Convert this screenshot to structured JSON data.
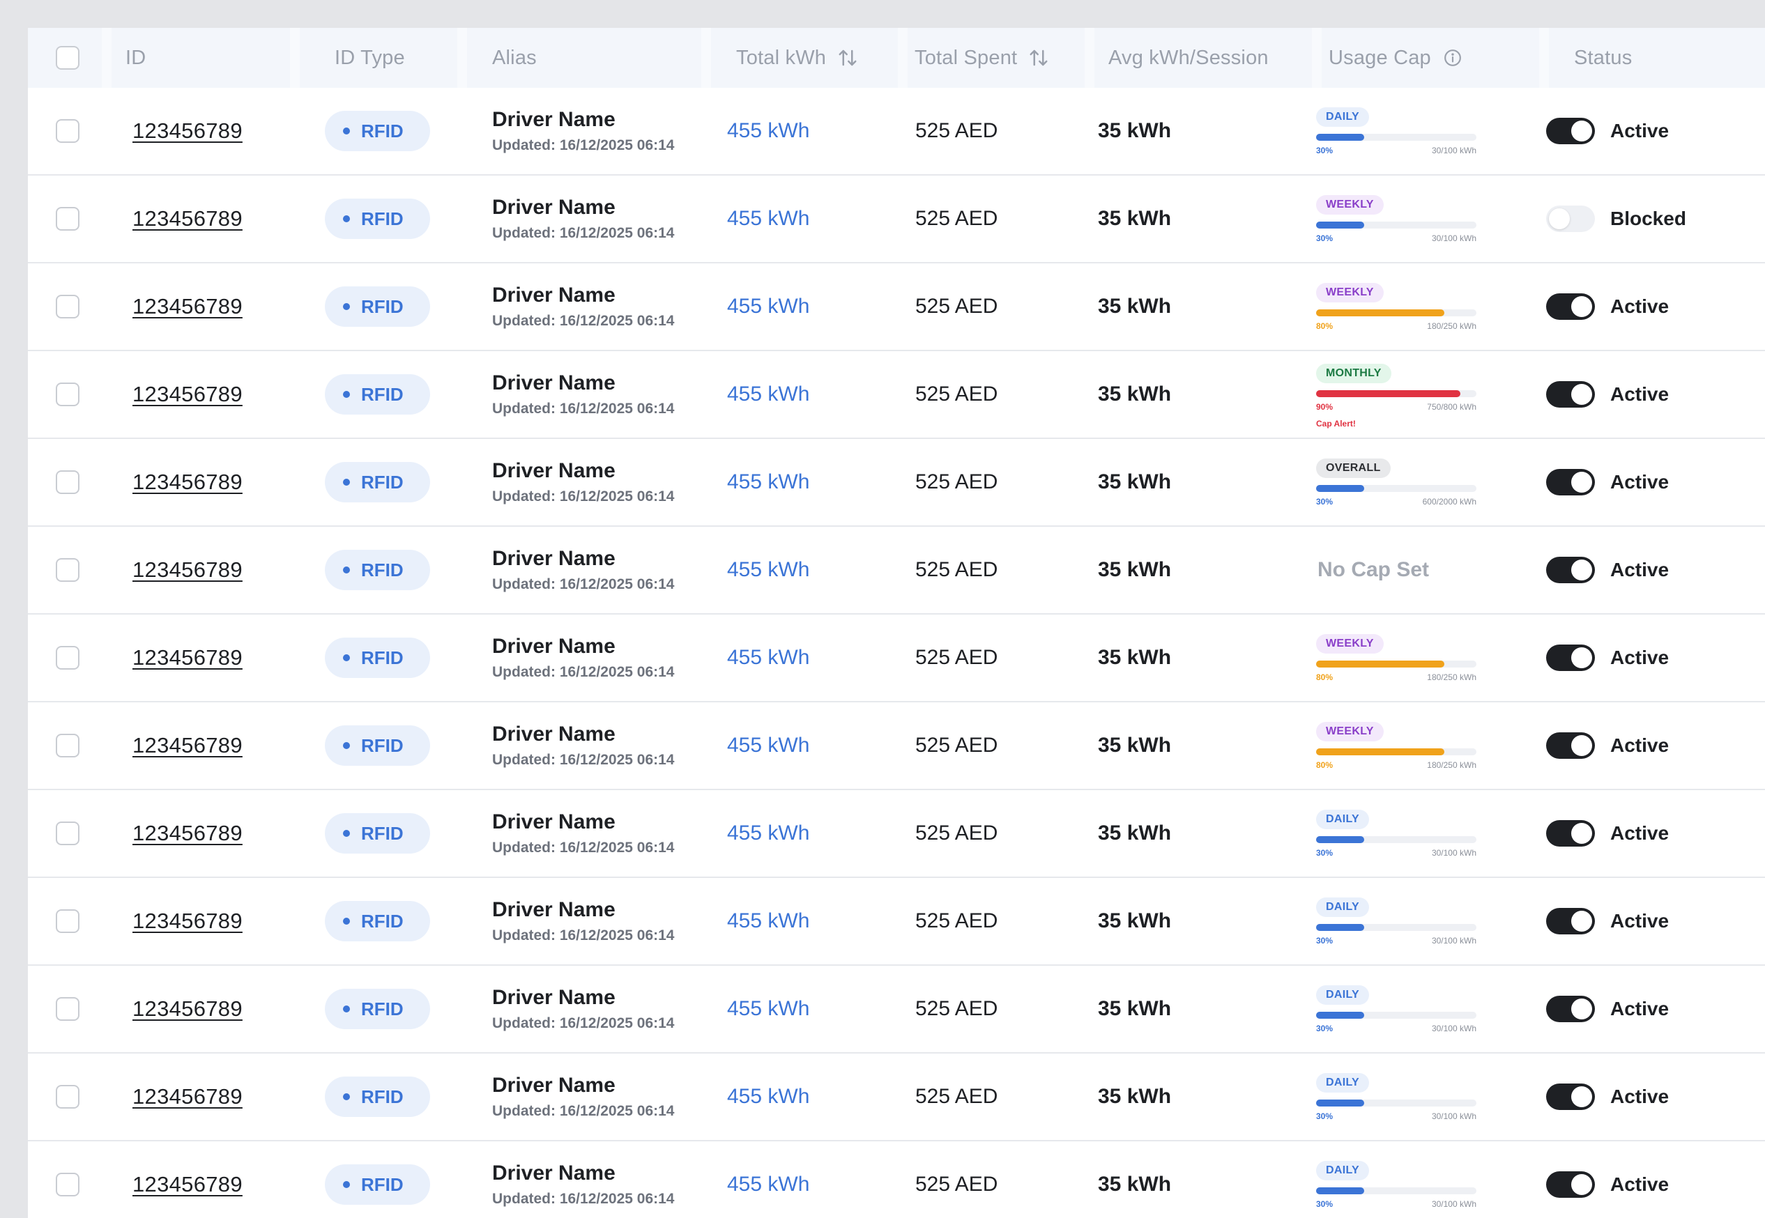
{
  "table": {
    "headers": {
      "id": "ID",
      "id_type": "ID Type",
      "alias": "Alias",
      "total_kwh": "Total kWh",
      "total_spent": "Total Spent",
      "avg": "Avg kWh/Session",
      "usage_cap": "Usage Cap",
      "status": "Status"
    },
    "icons": {
      "sort": "sort-arrows-icon",
      "info": "info-icon",
      "dot": "status-dot-icon"
    },
    "colors": {
      "accent_blue": "#3b74d6",
      "warning_orange": "#f0a21b",
      "danger_red": "#e03342",
      "toggle_on": "#1e2024",
      "muted_text": "#9aa0ab"
    },
    "rows": [
      {
        "id": "123456789",
        "id_type": "RFID",
        "name": "Driver Name",
        "updated": "Updated: 16/12/2025 06:14",
        "kwh": "455 kWh",
        "spent": "525 AED",
        "avg": "35 kWh",
        "cap": {
          "period": "DAILY",
          "color": "blue",
          "fraction": 0.3,
          "pct": "30%",
          "amount": "30/100 kWh",
          "alert": ""
        },
        "status": "Active",
        "on": true
      },
      {
        "id": "123456789",
        "id_type": "RFID",
        "name": "Driver Name",
        "updated": "Updated: 16/12/2025 06:14",
        "kwh": "455 kWh",
        "spent": "525 AED",
        "avg": "35 kWh",
        "cap": {
          "period": "WEEKLY",
          "color": "blue",
          "fraction": 0.3,
          "pct": "30%",
          "amount": "30/100 kWh",
          "alert": ""
        },
        "status": "Blocked",
        "on": false
      },
      {
        "id": "123456789",
        "id_type": "RFID",
        "name": "Driver Name",
        "updated": "Updated: 16/12/2025 06:14",
        "kwh": "455 kWh",
        "spent": "525 AED",
        "avg": "35 kWh",
        "cap": {
          "period": "WEEKLY",
          "color": "orange",
          "fraction": 0.8,
          "pct": "80%",
          "amount": "180/250 kWh",
          "alert": ""
        },
        "status": "Active",
        "on": true
      },
      {
        "id": "123456789",
        "id_type": "RFID",
        "name": "Driver Name",
        "updated": "Updated: 16/12/2025 06:14",
        "kwh": "455 kWh",
        "spent": "525 AED",
        "avg": "35 kWh",
        "cap": {
          "period": "MONTHLY",
          "color": "red",
          "fraction": 0.9,
          "pct": "90%",
          "amount": "750/800 kWh",
          "alert": "Cap Alert!"
        },
        "status": "Active",
        "on": true
      },
      {
        "id": "123456789",
        "id_type": "RFID",
        "name": "Driver Name",
        "updated": "Updated: 16/12/2025 06:14",
        "kwh": "455 kWh",
        "spent": "525 AED",
        "avg": "35 kWh",
        "cap": {
          "period": "OVERALL",
          "color": "blue",
          "fraction": 0.3,
          "pct": "30%",
          "amount": "600/2000 kWh",
          "alert": ""
        },
        "status": "Active",
        "on": true
      },
      {
        "id": "123456789",
        "id_type": "RFID",
        "name": "Driver Name",
        "updated": "Updated: 16/12/2025 06:14",
        "kwh": "455 kWh",
        "spent": "525 AED",
        "avg": "35 kWh",
        "cap": null,
        "no_cap": "No Cap Set",
        "status": "Active",
        "on": true
      },
      {
        "id": "123456789",
        "id_type": "RFID",
        "name": "Driver Name",
        "updated": "Updated: 16/12/2025 06:14",
        "kwh": "455 kWh",
        "spent": "525 AED",
        "avg": "35 kWh",
        "cap": {
          "period": "WEEKLY",
          "color": "orange",
          "fraction": 0.8,
          "pct": "80%",
          "amount": "180/250 kWh",
          "alert": ""
        },
        "status": "Active",
        "on": true
      },
      {
        "id": "123456789",
        "id_type": "RFID",
        "name": "Driver Name",
        "updated": "Updated: 16/12/2025 06:14",
        "kwh": "455 kWh",
        "spent": "525 AED",
        "avg": "35 kWh",
        "cap": {
          "period": "WEEKLY",
          "color": "orange",
          "fraction": 0.8,
          "pct": "80%",
          "amount": "180/250 kWh",
          "alert": ""
        },
        "status": "Active",
        "on": true
      },
      {
        "id": "123456789",
        "id_type": "RFID",
        "name": "Driver Name",
        "updated": "Updated: 16/12/2025 06:14",
        "kwh": "455 kWh",
        "spent": "525 AED",
        "avg": "35 kWh",
        "cap": {
          "period": "DAILY",
          "color": "blue",
          "fraction": 0.3,
          "pct": "30%",
          "amount": "30/100 kWh",
          "alert": ""
        },
        "status": "Active",
        "on": true
      },
      {
        "id": "123456789",
        "id_type": "RFID",
        "name": "Driver Name",
        "updated": "Updated: 16/12/2025 06:14",
        "kwh": "455 kWh",
        "spent": "525 AED",
        "avg": "35 kWh",
        "cap": {
          "period": "DAILY",
          "color": "blue",
          "fraction": 0.3,
          "pct": "30%",
          "amount": "30/100 kWh",
          "alert": ""
        },
        "status": "Active",
        "on": true
      },
      {
        "id": "123456789",
        "id_type": "RFID",
        "name": "Driver Name",
        "updated": "Updated: 16/12/2025 06:14",
        "kwh": "455 kWh",
        "spent": "525 AED",
        "avg": "35 kWh",
        "cap": {
          "period": "DAILY",
          "color": "blue",
          "fraction": 0.3,
          "pct": "30%",
          "amount": "30/100 kWh",
          "alert": ""
        },
        "status": "Active",
        "on": true
      },
      {
        "id": "123456789",
        "id_type": "RFID",
        "name": "Driver Name",
        "updated": "Updated: 16/12/2025 06:14",
        "kwh": "455 kWh",
        "spent": "525 AED",
        "avg": "35 kWh",
        "cap": {
          "period": "DAILY",
          "color": "blue",
          "fraction": 0.3,
          "pct": "30%",
          "amount": "30/100 kWh",
          "alert": ""
        },
        "status": "Active",
        "on": true
      },
      {
        "id": "123456789",
        "id_type": "RFID",
        "name": "Driver Name",
        "updated": "Updated: 16/12/2025 06:14",
        "kwh": "455 kWh",
        "spent": "525 AED",
        "avg": "35 kWh",
        "cap": {
          "period": "DAILY",
          "color": "blue",
          "fraction": 0.3,
          "pct": "30%",
          "amount": "30/100 kWh",
          "alert": ""
        },
        "status": "Active",
        "on": true
      }
    ]
  }
}
